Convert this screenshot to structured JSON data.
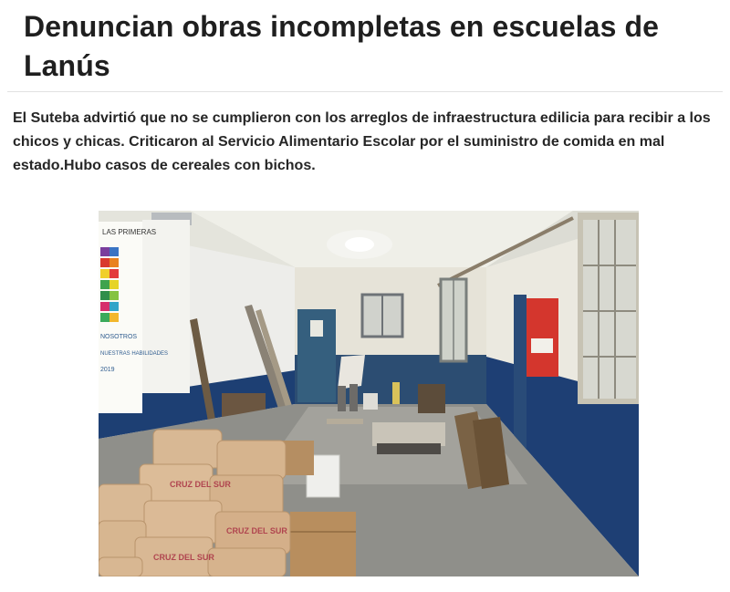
{
  "article": {
    "headline": "Denuncian obras incompletas en escuelas de Lanús",
    "lead": "El Suteba advirtió que no se cumplieron con los arreglos de infraestructura edilicia para recibir a los chicos y chicas. Criticaron al Servicio Alimentario Escolar por el suministro de comida en mal estado.Hubo casos de cereales con bichos.",
    "photo": {
      "wall_poster_lines": [
        "LAS PRIMERAS",
        "NOSOTROS",
        "NUESTRAS HABILIDADES",
        "2019"
      ],
      "sack_label": "CRUZ DEL SUR"
    }
  }
}
